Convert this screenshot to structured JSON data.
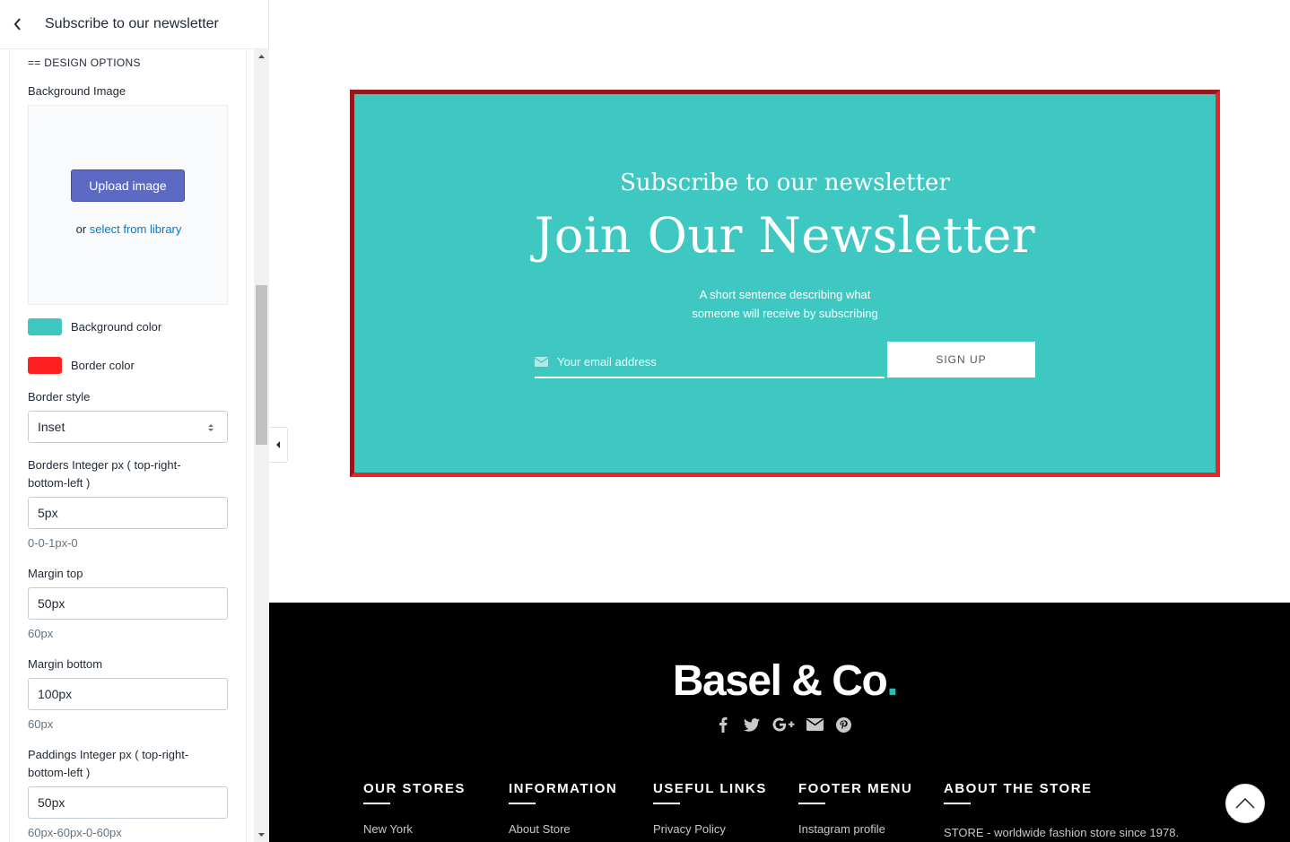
{
  "sidebar": {
    "title": "Subscribe to our newsletter",
    "section_heading": "== DESIGN OPTIONS",
    "background_image": {
      "label": "Background Image",
      "upload_label": "Upload image",
      "or_text": "or",
      "library_link": "select from library"
    },
    "background_color": {
      "label": "Background color",
      "value": "#3ec8c1"
    },
    "border_color": {
      "label": "Border color",
      "value": "#ff2020"
    },
    "border_style": {
      "label": "Border style",
      "value": "Inset"
    },
    "borders": {
      "label_line1": "Borders Integer px ( top-right-",
      "label_line2": "bottom-left )",
      "value": "5px",
      "hint": "0-0-1px-0"
    },
    "margin_top": {
      "label": "Margin top",
      "value": "50px",
      "hint": "60px"
    },
    "margin_bottom": {
      "label": "Margin bottom",
      "value": "100px",
      "hint": "60px"
    },
    "paddings": {
      "label_line1": "Paddings Integer px ( top-right-",
      "label_line2": "bottom-left )",
      "value": "50px",
      "hint": "60px-60px-0-60px"
    }
  },
  "preview": {
    "newsletter": {
      "subheading": "Subscribe to our newsletter",
      "heading": "Join Our Newsletter",
      "description_line1": "A short sentence describing what",
      "description_line2": "someone will receive by subscribing",
      "email_placeholder": "Your email address",
      "signup_label": "SIGN UP",
      "background_color": "#3ec8c1",
      "border_color": "#e8272b"
    },
    "footer": {
      "logo_text": "Basel & Co",
      "logo_dot": ".",
      "socials": [
        "facebook-icon",
        "twitter-icon",
        "google-plus-icon",
        "envelope-icon",
        "pinterest-icon"
      ],
      "columns": [
        {
          "heading": "OUR STORES",
          "first_item": "New York"
        },
        {
          "heading": "INFORMATION",
          "first_item": "About Store"
        },
        {
          "heading": "USEFUL LINKS",
          "first_item": "Privacy Policy"
        },
        {
          "heading": "FOOTER MENU",
          "first_item": "Instagram profile"
        },
        {
          "heading": "ABOUT THE STORE",
          "first_item": "STORE - worldwide fashion store since 1978."
        }
      ]
    }
  }
}
